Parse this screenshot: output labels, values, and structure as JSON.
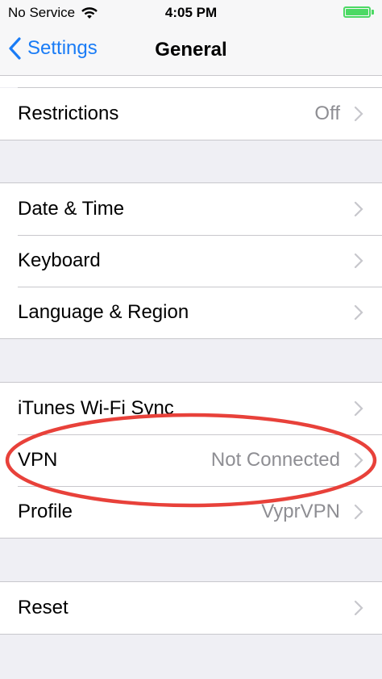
{
  "status_bar": {
    "carrier": "No Service",
    "time": "4:05 PM"
  },
  "nav": {
    "back_label": "Settings",
    "title": "General"
  },
  "groups": [
    {
      "rows": [
        {
          "label": "Restrictions",
          "value": "Off"
        }
      ]
    },
    {
      "rows": [
        {
          "label": "Date & Time",
          "value": ""
        },
        {
          "label": "Keyboard",
          "value": ""
        },
        {
          "label": "Language & Region",
          "value": ""
        }
      ]
    },
    {
      "rows": [
        {
          "label": "iTunes Wi-Fi Sync",
          "value": ""
        },
        {
          "label": "VPN",
          "value": "Not Connected"
        },
        {
          "label": "Profile",
          "value": "VyprVPN"
        }
      ]
    },
    {
      "rows": [
        {
          "label": "Reset",
          "value": ""
        }
      ]
    }
  ],
  "colors": {
    "accent": "#1a7cf6",
    "annotation": "#e8413a",
    "battery": "#4cd964",
    "background": "#efeff4"
  }
}
